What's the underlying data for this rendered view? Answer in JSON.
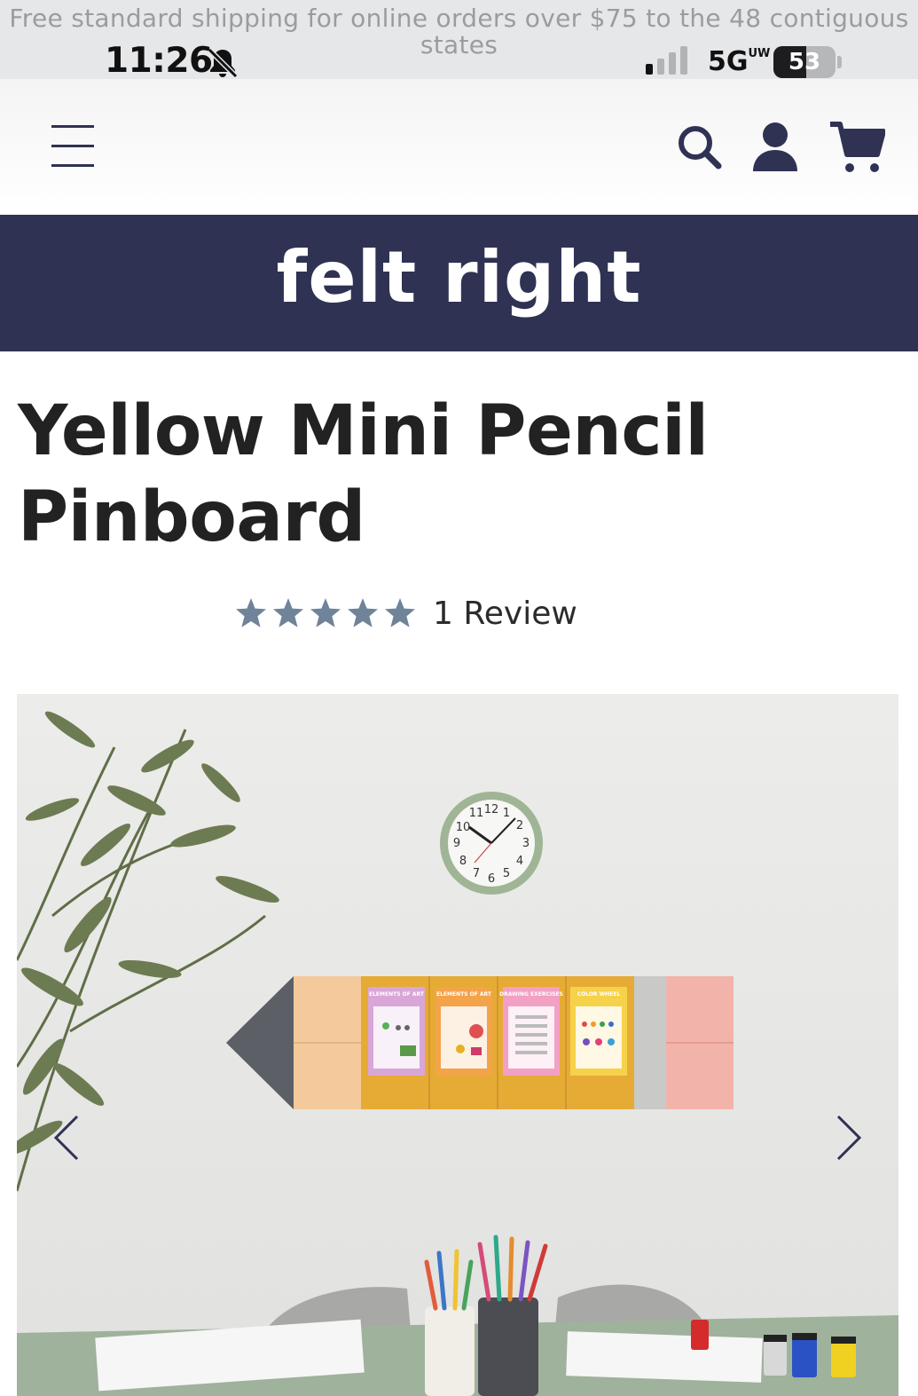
{
  "status_bar": {
    "promo": "Free standard shipping for online orders over $75 to the 48 contiguous states",
    "time": "11:26",
    "network": "5G",
    "network_sup": "UW",
    "battery": "53",
    "battery_level": 0.53
  },
  "header": {
    "icons": [
      "menu-icon",
      "search-icon",
      "account-icon",
      "cart-icon"
    ]
  },
  "brand": {
    "logo": "felt right",
    "color": "#2f3253"
  },
  "product": {
    "title": "Yellow Mini Pencil Pinboard",
    "rating": 5,
    "review_count": "1 Review",
    "star_color": "#6f8399"
  },
  "gallery": {
    "image_description_icon": "product-photo",
    "poster_labels": [
      "ELEMENTS OF ART",
      "ELEMENTS OF ART",
      "DRAWING EXERCISES",
      "COLOR WHEEL"
    ],
    "clock_numbers": [
      "12",
      "11",
      "10",
      "9",
      "2",
      "3",
      "4",
      "5",
      "6",
      "7",
      "8",
      "1"
    ]
  }
}
